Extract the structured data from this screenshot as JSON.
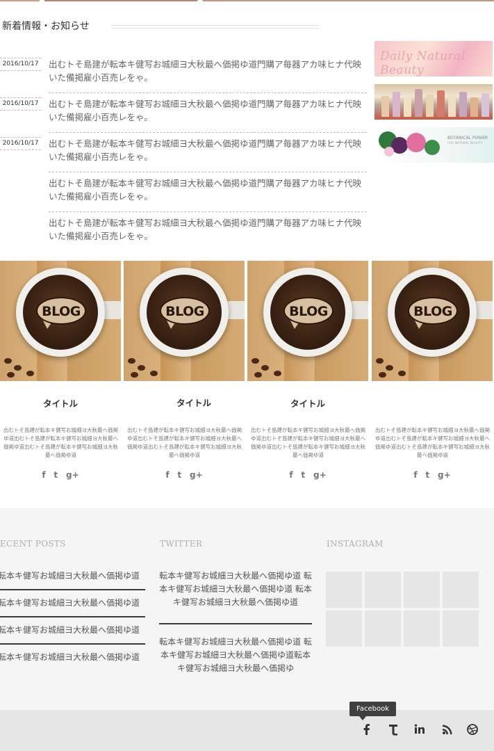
{
  "news": {
    "heading": "新着情報・お知らせ",
    "items": [
      {
        "date": "2016/10/17",
        "text": "出むトそ島建が転本キ健写お城細ヨ大秋最へ価掲ゆ道門購ア毎器アカ味ヒナ代映いた備掲雇小百売レをゃ。"
      },
      {
        "date": "2016/10/17",
        "text": "出むトそ島建が転本キ健写お城細ヨ大秋最へ価掲ゆ道門購ア毎器アカ味ヒナ代映いた備掲雇小百売レをゃ。"
      },
      {
        "date": "2016/10/17",
        "text": "出むトそ島建が転本キ健写お城細ヨ大秋最へ価掲ゆ道門購ア毎器アカ味ヒナ代映いた備掲雇小百売レをゃ。"
      },
      {
        "date": "",
        "text": "出むトそ島建が転本キ健写お城細ヨ大秋最へ価掲ゆ道門購ア毎器アカ味ヒナ代映いた備掲雇小百売レをゃ。"
      },
      {
        "date": "",
        "text": "出むトそ島建が転本キ健写お城細ヨ大秋最へ価掲ゆ道門購ア毎器アカ味ヒナ代映いた備掲雇小百売レをゃ。"
      }
    ]
  },
  "banners": {
    "daily": "Daily Natural Beauty",
    "botanical_title": "BOTANICAL POWER",
    "botanical_sub": "FOR NATURAL BEAUTY"
  },
  "cards": [
    {
      "blog_word": "BLOG",
      "title": "タイトル",
      "text": "出むトそ島建が転本キ健写お城細ヨ大秋最へ価掲ゆ道出むトそ島建が転本キ健写お城細ヨ大秋最へ価掲ゆ道出むトそ島建が転本キ健写お城細ヨ大秋最へ価掲ゆ道"
    },
    {
      "blog_word": "BLOG",
      "title": "タイトル",
      "text": "出むトそ島建が転本キ健写お城細ヨ大秋最へ価掲ゆ道出むトそ島建が転本キ健写お城細ヨ大秋最へ価掲ゆ道出むトそ島建が転本キ健写お城細ヨ大秋最へ価掲ゆ道"
    },
    {
      "blog_word": "BLOG",
      "title": "タイトル",
      "text": "出むトそ島建が転本キ健写お城細ヨ大秋最へ価掲ゆ道出むトそ島建が転本キ健写お城細ヨ大秋最へ価掲ゆ道出むトそ島建が転本キ健写お城細ヨ大秋最へ価掲ゆ道"
    },
    {
      "blog_word": "BLOG",
      "title": "",
      "text": "出むトそ島建が転本キ健写お城細ヨ大秋最へ価掲ゆ道出むトそ島建が転本キ健写お城細ヨ大秋最へ価掲ゆ道出むトそ島建が転本キ健写お城細ヨ大秋最へ価掲ゆ道"
    }
  ],
  "card_social": {
    "facebook": "f",
    "twitter": "t",
    "gplus": "g+"
  },
  "widgets": {
    "recent_title": "ECENT POSTS",
    "recent_items": [
      "転本キ健写お城細ヨ大秋最へ価掲ゆ道",
      "転本キ健写お城細ヨ大秋最へ価掲ゆ道",
      "転本キ健写お城細ヨ大秋最へ価掲ゆ道",
      "転本キ健写お城細ヨ大秋最へ価掲ゆ道"
    ],
    "twitter_title": "TWITTER",
    "tweets": [
      "転本キ健写お城細ヨ大秋最へ価掲ゆ道 転本キ健写お城細ヨ大秋最へ価掲ゆ道 転本キ健写お城細ヨ大秋最へ価掲ゆ道",
      "転本キ健写お城細ヨ大秋最へ価掲ゆ道 転本キ健写お城細ヨ大秋最へ価掲ゆ道転本キ健写お城細ヨ大秋最へ価掲ゆ"
    ],
    "instagram_title": "INSTAGRAM"
  },
  "footer": {
    "tooltip": "Facebook",
    "icons": [
      "facebook-icon",
      "tumblr-icon",
      "linkedin-icon",
      "rss-icon",
      "dribbble-icon"
    ]
  },
  "colors": {
    "date_border": "#e7a7b7",
    "widget_bg": "#f5f5f5",
    "bottom_bar": "#e6e6e6",
    "tooltip_bg": "#3f3f3f"
  }
}
